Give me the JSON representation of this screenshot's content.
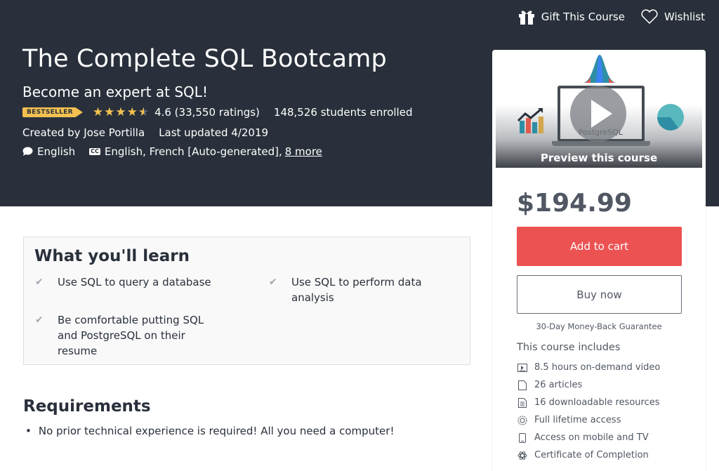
{
  "header": {
    "gift_label": "Gift This Course",
    "wishlist_label": "Wishlist",
    "title": "The Complete SQL Bootcamp",
    "subtitle": "Become an expert at SQL!",
    "badge": "BESTSELLER",
    "rating_stars": 4.6,
    "rating_text": "4.6 (33,550 ratings)",
    "enrolled": "148,526 students enrolled",
    "created_by": "Created by Jose Portilla",
    "last_updated": "Last updated 4/2019",
    "language": "English",
    "captions": "English, French [Auto-generated],",
    "captions_more": "8 more"
  },
  "sidebar": {
    "preview_label": "Preview this course",
    "preview_logo_text": "PostgreSQL",
    "price": "$194.99",
    "add_to_cart": "Add to cart",
    "buy_now": "Buy now",
    "guarantee": "30-Day Money-Back Guarantee",
    "includes_title": "This course includes",
    "includes": [
      {
        "icon": "video-icon",
        "label": "8.5 hours on-demand video"
      },
      {
        "icon": "article-icon",
        "label": "26 articles"
      },
      {
        "icon": "resource-icon",
        "label": "16 downloadable resources"
      },
      {
        "icon": "lifetime-icon",
        "label": "Full lifetime access"
      },
      {
        "icon": "mobile-icon",
        "label": "Access on mobile and TV"
      },
      {
        "icon": "certificate-icon",
        "label": "Certificate of Completion"
      }
    ]
  },
  "learn": {
    "title": "What you'll learn",
    "items": [
      "Use SQL to query a database",
      "Use SQL to perform data analysis",
      "Be comfortable putting SQL and PostgreSQL on their resume"
    ]
  },
  "requirements": {
    "title": "Requirements",
    "items": [
      "No prior technical experience is required! All you need a computer!"
    ]
  }
}
